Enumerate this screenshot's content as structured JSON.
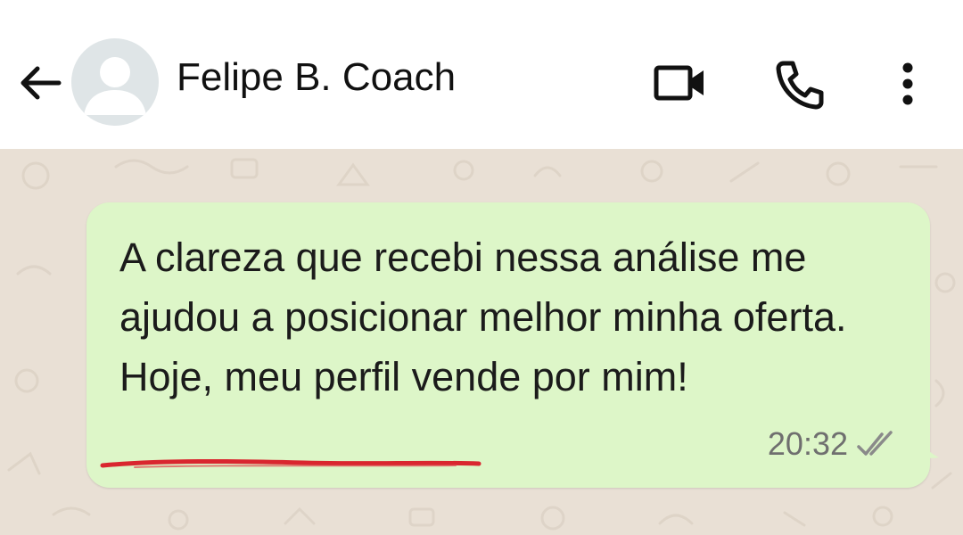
{
  "header": {
    "contact_name": "Felipe B. Coach",
    "icons": {
      "back": "arrow-left-icon",
      "avatar": "default-avatar-icon",
      "video": "video-camera-icon",
      "call": "phone-icon",
      "menu": "more-vertical-icon"
    }
  },
  "message": {
    "text": "A clareza que recebi nessa análise me ajudou a posicionar melhor minha oferta. Hoje, meu perfil vende por mim!",
    "time": "20:32",
    "status_icon": "double-check-icon"
  },
  "colors": {
    "header_bg": "#ffffff",
    "chat_bg": "#e9e0d5",
    "bubble_bg": "#ddf6c8",
    "underline": "#d9262f",
    "icon": "#111111"
  }
}
